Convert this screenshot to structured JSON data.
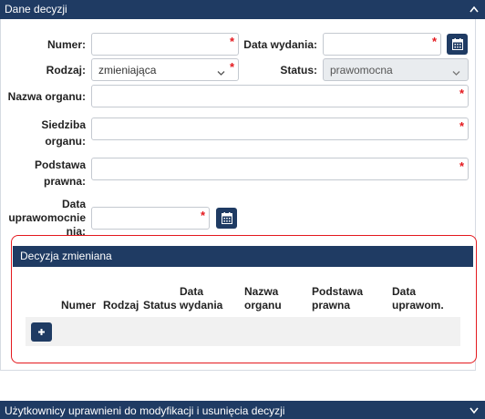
{
  "section": {
    "title": "Dane decyzji"
  },
  "form": {
    "numer": {
      "label": "Numer:",
      "value": ""
    },
    "data_wydania": {
      "label": "Data wydania:",
      "value": ""
    },
    "rodzaj": {
      "label": "Rodzaj:",
      "value": "zmieniająca"
    },
    "status": {
      "label": "Status:",
      "value": "prawomocna"
    },
    "nazwa_organu": {
      "label": "Nazwa organu:",
      "value": ""
    },
    "siedziba_organu": {
      "label_line1": "Siedziba",
      "label_line2": "organu:",
      "value": ""
    },
    "podstawa_prawna": {
      "label_line1": "Podstawa",
      "label_line2": "prawna:",
      "value": ""
    },
    "data_uprawomocnienia": {
      "label_line1": "Data",
      "label_line2": "uprawomocnie",
      "label_line3": "nia:",
      "value": ""
    }
  },
  "required_mark": "*",
  "subsection": {
    "title": "Decyzja zmieniana",
    "columns": [
      {
        "line1": "Numer",
        "line2": ""
      },
      {
        "line1": "Rodzaj",
        "line2": ""
      },
      {
        "line1": "Status",
        "line2": ""
      },
      {
        "line1": "Data",
        "line2": "wydania"
      },
      {
        "line1": "Nazwa",
        "line2": "organu"
      },
      {
        "line1": "Podstawa",
        "line2": "prawna"
      },
      {
        "line1": "Data",
        "line2": "uprawom."
      }
    ],
    "add_button": "+"
  },
  "footer_section": {
    "title": "Użytkownicy uprawnieni do modyfikacji i usunięcia decyzji"
  },
  "colors": {
    "header": "#1f3b63",
    "required": "#e4191e",
    "highlight_border": "#e4191e"
  },
  "icons": {
    "calendar": "calendar-icon",
    "chevron": "chevron-down-icon",
    "add": "plus-icon"
  }
}
